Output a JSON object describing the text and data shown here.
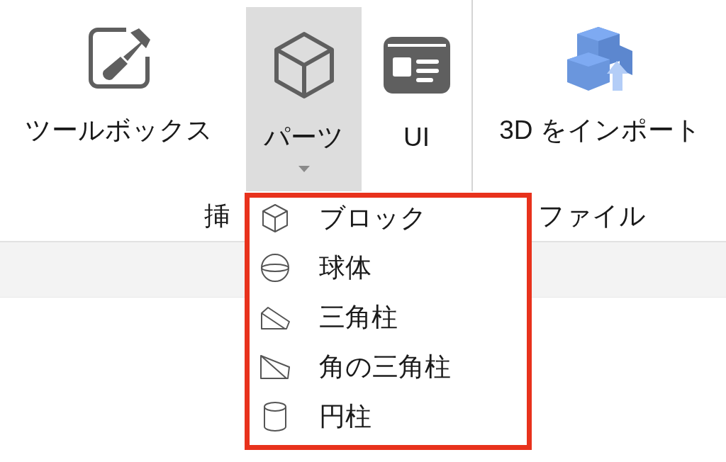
{
  "ribbon": {
    "tools": [
      {
        "label": "ツールボックス",
        "kind": "button",
        "pressed": false
      },
      {
        "label": "パーツ",
        "kind": "dropdown",
        "pressed": true
      },
      {
        "label": "UI",
        "kind": "button",
        "pressed": false
      },
      {
        "label": "3D をインポート",
        "kind": "button",
        "pressed": false
      }
    ],
    "groups": [
      "挿",
      "ファイル"
    ]
  },
  "parts_menu": {
    "items": [
      {
        "label": "ブロック"
      },
      {
        "label": "球体"
      },
      {
        "label": "三角柱"
      },
      {
        "label": "角の三角柱"
      },
      {
        "label": "円柱"
      }
    ]
  }
}
